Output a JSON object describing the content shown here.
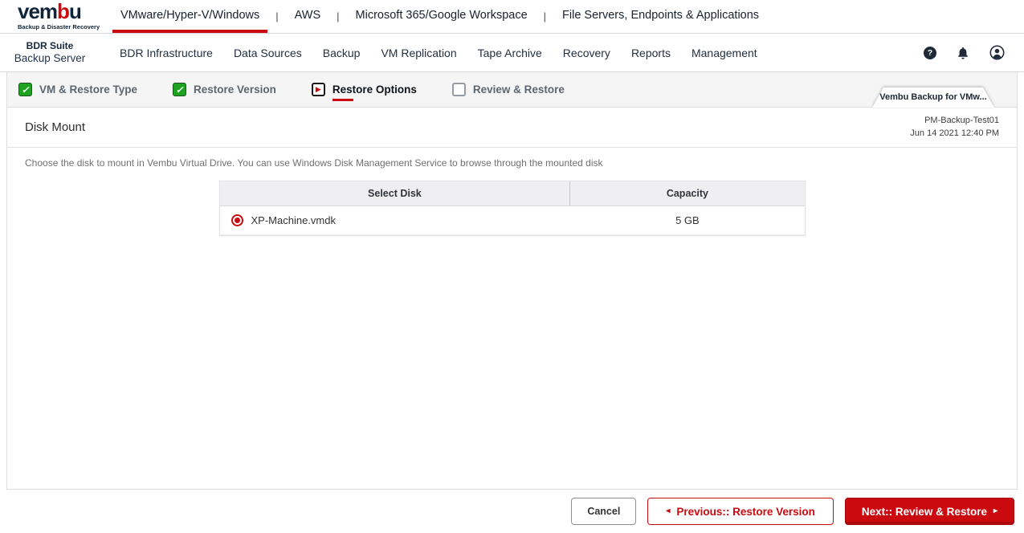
{
  "colors": {
    "brand_red": "#cb0a10",
    "nav_dark": "#1e2a38",
    "completed_green": "#1da320"
  },
  "brand": {
    "logo_prefix": "vem",
    "logo_red": "b",
    "logo_suffix": "u",
    "tagline": "Backup & Disaster Recovery"
  },
  "product_tabs": {
    "separator": "|",
    "items": [
      {
        "label": "VMware/Hyper-V/Windows",
        "active": true
      },
      {
        "label": "AWS",
        "active": false
      },
      {
        "label": "Microsoft 365/Google Workspace",
        "active": false
      },
      {
        "label": "File Servers, Endpoints & Applications",
        "active": false
      }
    ]
  },
  "main_nav": {
    "suite_title": "BDR Suite",
    "suite_subtitle": "Backup Server",
    "items": [
      "BDR Infrastructure",
      "Data Sources",
      "Backup",
      "VM Replication",
      "Tape Archive",
      "Recovery",
      "Reports",
      "Management"
    ],
    "icons": [
      {
        "name": "help-icon",
        "glyph": "?"
      },
      {
        "name": "notifications-icon"
      },
      {
        "name": "account-icon"
      }
    ]
  },
  "wizard": {
    "check_glyph": "✓",
    "current_glyph": "▶",
    "steps": [
      {
        "label": "VM & Restore Type",
        "state": "completed"
      },
      {
        "label": "Restore Version",
        "state": "completed"
      },
      {
        "label": "Restore Options",
        "state": "current"
      },
      {
        "label": "Review & Restore",
        "state": "pending"
      }
    ],
    "context_tab": "Vembu Backup for VMw..."
  },
  "page": {
    "title": "Disk Mount",
    "backup_name": "PM-Backup-Test01",
    "backup_time": "Jun 14 2021 12:40 PM",
    "description": "Choose the disk to mount in Vembu Virtual Drive. You can use Windows Disk Management Service to browse through the mounted disk"
  },
  "disk_table": {
    "columns": [
      "Select Disk",
      "Capacity"
    ],
    "rows": [
      {
        "disk": "XP-Machine.vmdk",
        "capacity": "5 GB",
        "selected": true
      }
    ]
  },
  "footer": {
    "cancel_label": "Cancel",
    "previous_label": "Previous:: Restore Version",
    "next_label": "Next:: Review & Restore",
    "prev_arrow": "◂",
    "next_arrow": "▸"
  }
}
